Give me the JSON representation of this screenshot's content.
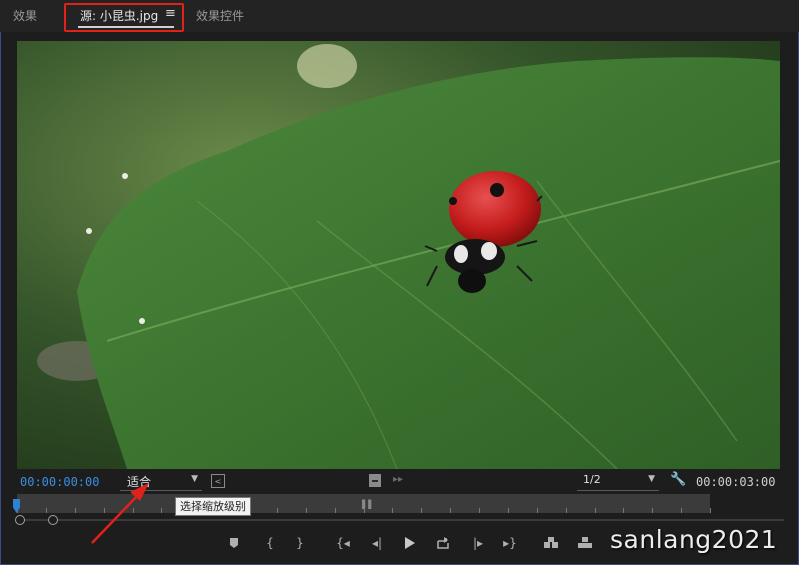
{
  "tabs": {
    "effects": "效果",
    "source": "源: 小昆虫.jpg",
    "source_menu_icon": "hamburger-menu-icon",
    "effect_controls": "效果控件"
  },
  "controls": {
    "current_timecode": "00:00:00:00",
    "duration_timecode": "00:00:03:00",
    "zoom_level": "适合",
    "resolution": "1/2",
    "tooltip": "选择缩放级别"
  },
  "transport_icons": [
    "add-marker-icon",
    "mark-in-icon",
    "mark-out-icon",
    "go-to-in-icon",
    "step-back-icon",
    "play-icon",
    "step-forward-icon",
    "go-to-out-icon",
    "insert-icon",
    "overwrite-icon",
    "export-frame-icon"
  ],
  "watermark": "sanlang2021",
  "colors": {
    "accent_blue": "#3a8fe0",
    "highlight_red": "#e0221b",
    "panel_bg": "#1d1d1d"
  }
}
